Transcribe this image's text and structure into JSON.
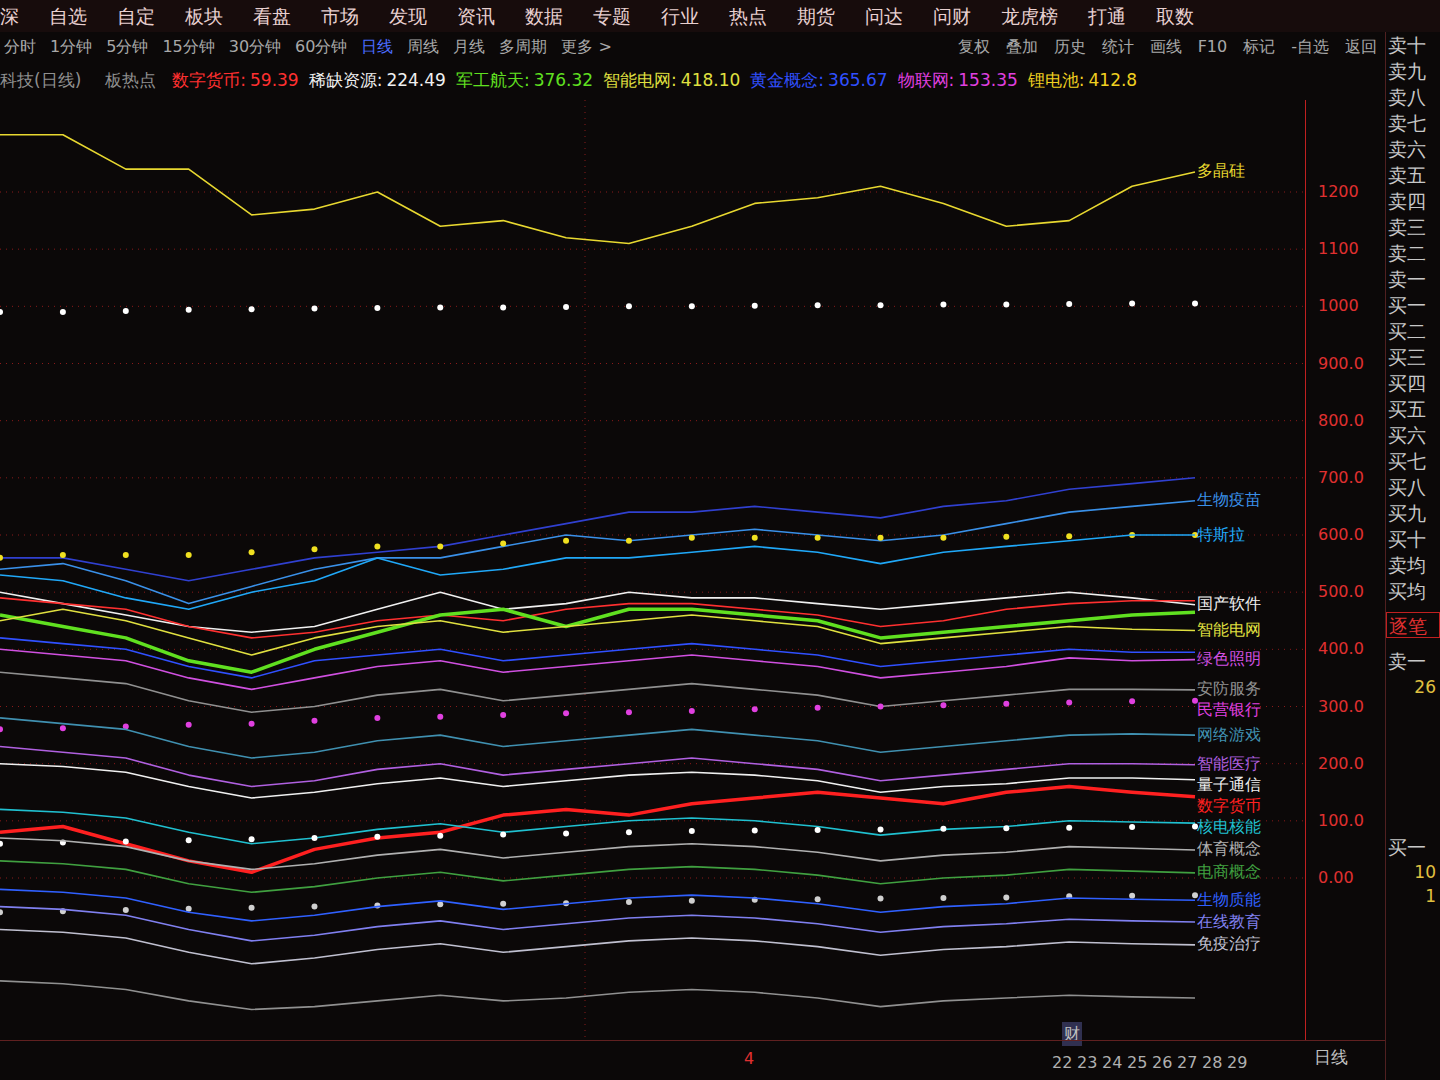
{
  "menu": [
    "深",
    "自选",
    "自定",
    "板块",
    "看盘",
    "市场",
    "发现",
    "资讯",
    "数据",
    "专题",
    "行业",
    "热点",
    "期货",
    "问达",
    "问财",
    "龙虎榜",
    "打通",
    "取数"
  ],
  "periods": [
    {
      "label": "分时",
      "selected": false
    },
    {
      "label": "1分钟",
      "selected": false
    },
    {
      "label": "5分钟",
      "selected": false
    },
    {
      "label": "15分钟",
      "selected": false
    },
    {
      "label": "30分钟",
      "selected": false
    },
    {
      "label": "60分钟",
      "selected": false
    },
    {
      "label": "日线",
      "selected": true
    },
    {
      "label": "周线",
      "selected": false
    },
    {
      "label": "月线",
      "selected": false
    },
    {
      "label": "多周期",
      "selected": false
    },
    {
      "label": "更多 >",
      "selected": false
    }
  ],
  "tools": [
    "复权",
    "叠加",
    "历史",
    "统计",
    "画线",
    "F10",
    "标记",
    "-自选",
    "返回"
  ],
  "legend": {
    "title": "科技(日线)",
    "hot": "板热点",
    "items": [
      {
        "label": "数字货币:",
        "value": "59.39",
        "color": "#ff3030"
      },
      {
        "label": "稀缺资源:",
        "value": "224.49",
        "color": "#f0f0f0"
      },
      {
        "label": "军工航天:",
        "value": "376.32",
        "color": "#60e020"
      },
      {
        "label": "智能电网:",
        "value": "418.10",
        "color": "#e0e040"
      },
      {
        "label": "黄金概念:",
        "value": "365.67",
        "color": "#3050ff"
      },
      {
        "label": "物联网:",
        "value": "153.35",
        "color": "#e040e0"
      },
      {
        "label": "锂电池:",
        "value": "412.8",
        "color": "#f0d020"
      }
    ]
  },
  "chart": {
    "y_ticks": [
      {
        "label": "1200",
        "value": 1200
      },
      {
        "label": "1100",
        "value": 1100
      },
      {
        "label": "1000",
        "value": 1000
      },
      {
        "label": "900.0",
        "value": 900
      },
      {
        "label": "800.0",
        "value": 800
      },
      {
        "label": "700.0",
        "value": 700
      },
      {
        "label": "600.0",
        "value": 600
      },
      {
        "label": "500.0",
        "value": 500
      },
      {
        "label": "400.0",
        "value": 400
      },
      {
        "label": "300.0",
        "value": 300
      },
      {
        "label": "200.0",
        "value": 200
      },
      {
        "label": "100.0",
        "value": 100
      },
      {
        "label": "0.00",
        "value": 0
      }
    ],
    "series": [
      {
        "label": "多晶硅",
        "color": "#e8d830",
        "kind": "line",
        "values": [
          1300,
          1300,
          1240,
          1240,
          1160,
          1170,
          1200,
          1140,
          1150,
          1120,
          1110,
          1140,
          1180,
          1190,
          1210,
          1180,
          1140,
          1150,
          1210,
          1235
        ]
      },
      {
        "color": "#ffffff",
        "kind": "dots",
        "values": [
          990,
          990,
          992,
          994,
          995,
          996,
          997,
          998,
          998,
          999,
          1000,
          1000,
          1001,
          1002,
          1002,
          1003,
          1003,
          1004,
          1005,
          1005
        ]
      },
      {
        "color": "#3040d0",
        "kind": "line",
        "values": [
          560,
          560,
          540,
          520,
          540,
          560,
          570,
          580,
          600,
          620,
          640,
          640,
          650,
          640,
          630,
          650,
          660,
          680,
          690,
          700
        ]
      },
      {
        "label": "生物疫苗",
        "color": "#3a90e8",
        "kind": "line",
        "values": [
          540,
          550,
          520,
          480,
          510,
          540,
          560,
          560,
          580,
          600,
          590,
          600,
          610,
          600,
          590,
          600,
          620,
          640,
          650,
          660
        ]
      },
      {
        "color": "#f0e020",
        "kind": "dots",
        "values": [
          560,
          565,
          565,
          565,
          570,
          575,
          580,
          580,
          585,
          590,
          590,
          595,
          595,
          595,
          595,
          595,
          597,
          598,
          600,
          600
        ]
      },
      {
        "label": "特斯拉",
        "color": "#20a8f8",
        "kind": "line",
        "values": [
          530,
          520,
          490,
          470,
          500,
          520,
          560,
          530,
          540,
          560,
          560,
          570,
          580,
          570,
          550,
          570,
          580,
          590,
          600,
          600
        ]
      },
      {
        "label": "国产软件",
        "color": "#f0f0f0",
        "kind": "line",
        "values": [
          500,
          480,
          460,
          440,
          430,
          440,
          470,
          500,
          470,
          480,
          500,
          490,
          490,
          480,
          470,
          480,
          490,
          500,
          490,
          478
        ]
      },
      {
        "color": "#ff3030",
        "kind": "line",
        "values": [
          490,
          480,
          470,
          440,
          420,
          430,
          450,
          460,
          450,
          470,
          480,
          480,
          470,
          460,
          440,
          450,
          470,
          480,
          485,
          485
        ]
      },
      {
        "color": "#60e020",
        "kind": "bold_line",
        "values": [
          460,
          440,
          420,
          380,
          360,
          400,
          430,
          460,
          470,
          440,
          470,
          470,
          460,
          450,
          420,
          430,
          440,
          450,
          460,
          465
        ]
      },
      {
        "label": "智能电网",
        "color": "#e0e040",
        "kind": "line",
        "values": [
          450,
          470,
          450,
          420,
          390,
          420,
          440,
          450,
          430,
          440,
          450,
          460,
          450,
          440,
          410,
          420,
          430,
          440,
          435,
          433
        ]
      },
      {
        "color": "#3050ff",
        "kind": "line",
        "values": [
          420,
          410,
          400,
          370,
          350,
          380,
          390,
          400,
          380,
          390,
          400,
          410,
          400,
          390,
          370,
          380,
          390,
          400,
          395,
          395
        ]
      },
      {
        "label": "绿色照明",
        "color": "#d050e0",
        "kind": "line",
        "values": [
          400,
          390,
          380,
          350,
          330,
          350,
          370,
          380,
          360,
          370,
          380,
          390,
          380,
          370,
          350,
          360,
          370,
          385,
          380,
          382
        ]
      },
      {
        "label": "安防服务",
        "color": "#909090",
        "kind": "line",
        "values": [
          360,
          350,
          340,
          310,
          290,
          300,
          320,
          330,
          310,
          320,
          330,
          340,
          330,
          320,
          300,
          310,
          320,
          330,
          330,
          329
        ]
      },
      {
        "label": "民营银行",
        "color": "#e040e0",
        "kind": "dots",
        "values": [
          260,
          262,
          265,
          268,
          270,
          275,
          280,
          282,
          285,
          288,
          290,
          292,
          295,
          298,
          300,
          302,
          305,
          307,
          309,
          310
        ]
      },
      {
        "label": "网络游戏",
        "color": "#4090b0",
        "kind": "line",
        "values": [
          280,
          270,
          260,
          230,
          210,
          220,
          240,
          250,
          230,
          240,
          250,
          260,
          250,
          240,
          220,
          230,
          240,
          250,
          252,
          250
        ]
      },
      {
        "label": "智能医疗",
        "color": "#b060e0",
        "kind": "line",
        "values": [
          230,
          220,
          210,
          180,
          160,
          170,
          190,
          200,
          180,
          190,
          200,
          210,
          200,
          190,
          170,
          180,
          190,
          200,
          200,
          198
        ]
      },
      {
        "label": "量子通信",
        "color": "#f0f0f0",
        "kind": "line",
        "values": [
          200,
          195,
          185,
          160,
          140,
          150,
          165,
          175,
          160,
          170,
          180,
          185,
          180,
          170,
          150,
          160,
          165,
          175,
          175,
          172
        ]
      },
      {
        "label": "数字货币",
        "color": "#ff2020",
        "kind": "bold_line",
        "values": [
          80,
          90,
          60,
          30,
          10,
          50,
          70,
          80,
          110,
          120,
          110,
          130,
          140,
          150,
          140,
          130,
          150,
          160,
          150,
          142
        ]
      },
      {
        "label": "核电核能",
        "color": "#20c0d0",
        "kind": "line",
        "values": [
          120,
          115,
          105,
          80,
          60,
          70,
          85,
          95,
          80,
          90,
          100,
          105,
          100,
          90,
          75,
          85,
          90,
          100,
          98,
          96
        ]
      },
      {
        "color": "#ffffff",
        "kind": "dots",
        "values": [
          60,
          62,
          64,
          66,
          68,
          70,
          72,
          74,
          76,
          78,
          80,
          82,
          83,
          84,
          85,
          86,
          87,
          88,
          89,
          90
        ]
      },
      {
        "label": "体育概念",
        "color": "#b0b0b0",
        "kind": "line",
        "values": [
          70,
          65,
          55,
          30,
          15,
          25,
          40,
          50,
          35,
          45,
          55,
          60,
          55,
          45,
          30,
          40,
          45,
          55,
          52,
          49
        ]
      },
      {
        "label": "电商概念",
        "color": "#40a040",
        "kind": "line",
        "values": [
          30,
          25,
          15,
          -10,
          -25,
          -15,
          0,
          10,
          -5,
          5,
          15,
          20,
          15,
          5,
          -10,
          0,
          5,
          15,
          12,
          9
        ]
      },
      {
        "color": "#d0d0d0",
        "kind": "dots",
        "values": [
          -60,
          -58,
          -56,
          -54,
          -52,
          -50,
          -48,
          -46,
          -45,
          -44,
          -42,
          -40,
          -38,
          -37,
          -36,
          -35,
          -34,
          -32,
          -31,
          -30
        ]
      },
      {
        "label": "生物质能",
        "color": "#3060ff",
        "kind": "line",
        "values": [
          -20,
          -25,
          -35,
          -60,
          -75,
          -65,
          -50,
          -40,
          -55,
          -45,
          -35,
          -30,
          -35,
          -45,
          -60,
          -50,
          -45,
          -35,
          -37,
          -39
        ]
      },
      {
        "label": "在线教育",
        "color": "#8080f0",
        "kind": "line",
        "values": [
          -50,
          -55,
          -65,
          -90,
          -110,
          -100,
          -85,
          -75,
          -90,
          -80,
          -70,
          -65,
          -70,
          -80,
          -95,
          -85,
          -80,
          -72,
          -75,
          -77
        ]
      },
      {
        "label": "免疫治疗",
        "color": "#c0c0d0",
        "kind": "line",
        "values": [
          -90,
          -95,
          -105,
          -130,
          -150,
          -140,
          -125,
          -115,
          -130,
          -120,
          -110,
          -105,
          -110,
          -120,
          -135,
          -125,
          -120,
          -112,
          -115,
          -117
        ]
      },
      {
        "color": "#909090",
        "kind": "line",
        "values": [
          -180,
          -185,
          -195,
          -215,
          -230,
          -225,
          -215,
          -205,
          -215,
          -210,
          -200,
          -195,
          -200,
          -210,
          -225,
          -215,
          -210,
          -205,
          -208,
          -210
        ]
      }
    ],
    "marker": "财",
    "month_mark": "4",
    "date_ticks": [
      "22",
      "23",
      "24",
      "25",
      "26",
      "27",
      "28",
      "29"
    ],
    "period_label": "日线"
  },
  "order_book": {
    "levels": [
      "卖十",
      "卖九",
      "卖八",
      "卖七",
      "卖六",
      "卖五",
      "卖四",
      "卖三",
      "卖二",
      "卖一",
      "买一",
      "买二",
      "买三",
      "买四",
      "买五",
      "买六",
      "买七",
      "买八",
      "买九",
      "买十",
      "卖均",
      "买均"
    ],
    "tick_tab": "逐笔",
    "sell1": {
      "label": "卖一",
      "value": "26"
    },
    "buy1": {
      "label": "买一",
      "values": [
        "10",
        "1"
      ]
    }
  }
}
